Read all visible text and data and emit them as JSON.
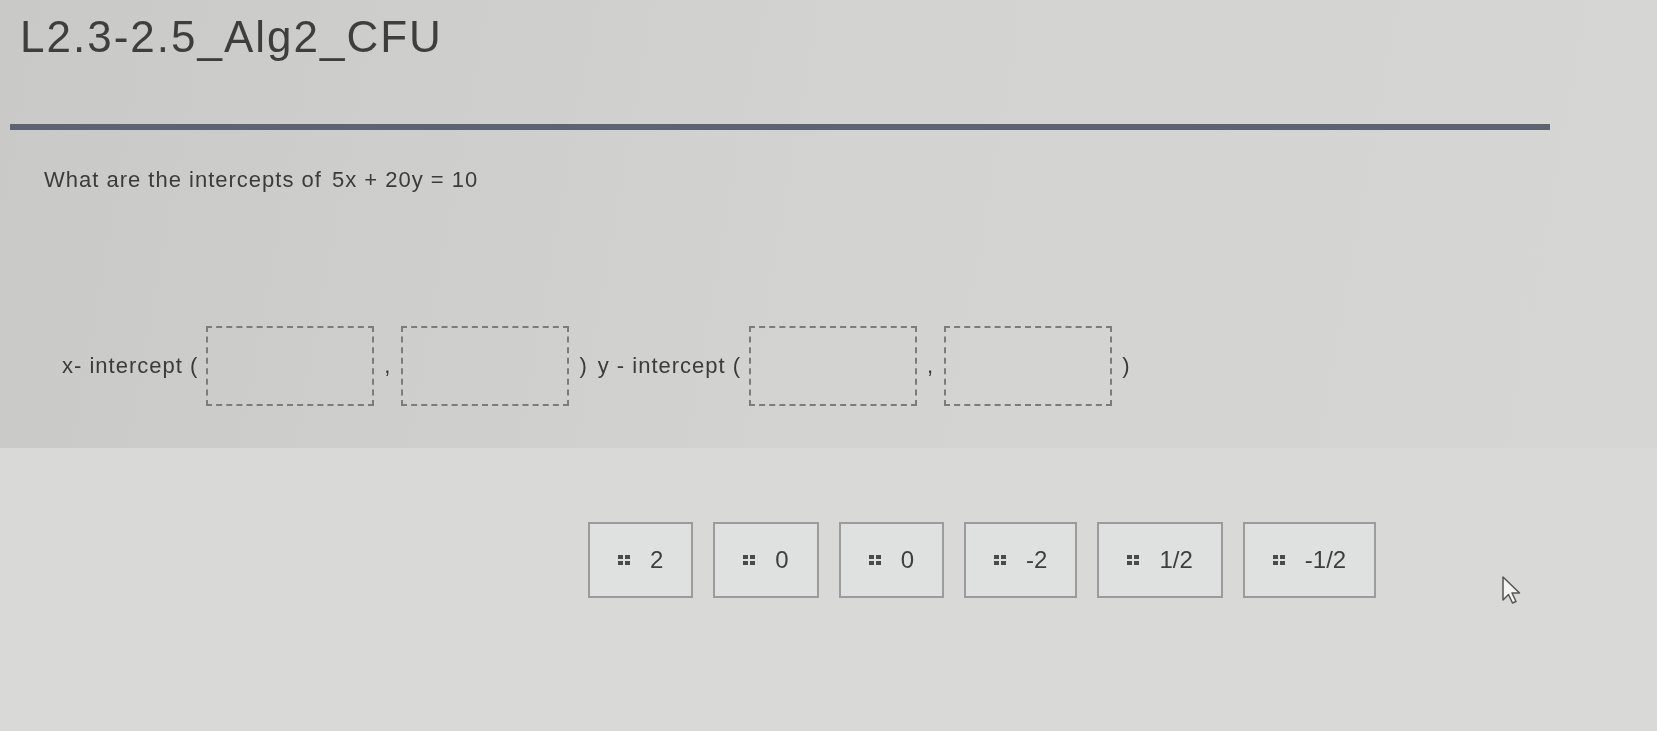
{
  "title": "L2.3-2.5_Alg2_CFU",
  "question": {
    "text": "What are the intercepts of",
    "equation": "5x + 20y = 10"
  },
  "answer_row": [
    {
      "kind": "text",
      "text": "x- intercept ("
    },
    {
      "kind": "blank"
    },
    {
      "kind": "text",
      "text": ","
    },
    {
      "kind": "blank"
    },
    {
      "kind": "text",
      "text": ")"
    },
    {
      "kind": "text",
      "text": "y - intercept ("
    },
    {
      "kind": "blank"
    },
    {
      "kind": "text",
      "text": ","
    },
    {
      "kind": "blank"
    },
    {
      "kind": "text",
      "text": ")"
    }
  ],
  "choices": [
    {
      "label": "2"
    },
    {
      "label": "0"
    },
    {
      "label": "0"
    },
    {
      "label": "-2"
    },
    {
      "label": "1/2"
    },
    {
      "label": "-1/2"
    }
  ]
}
